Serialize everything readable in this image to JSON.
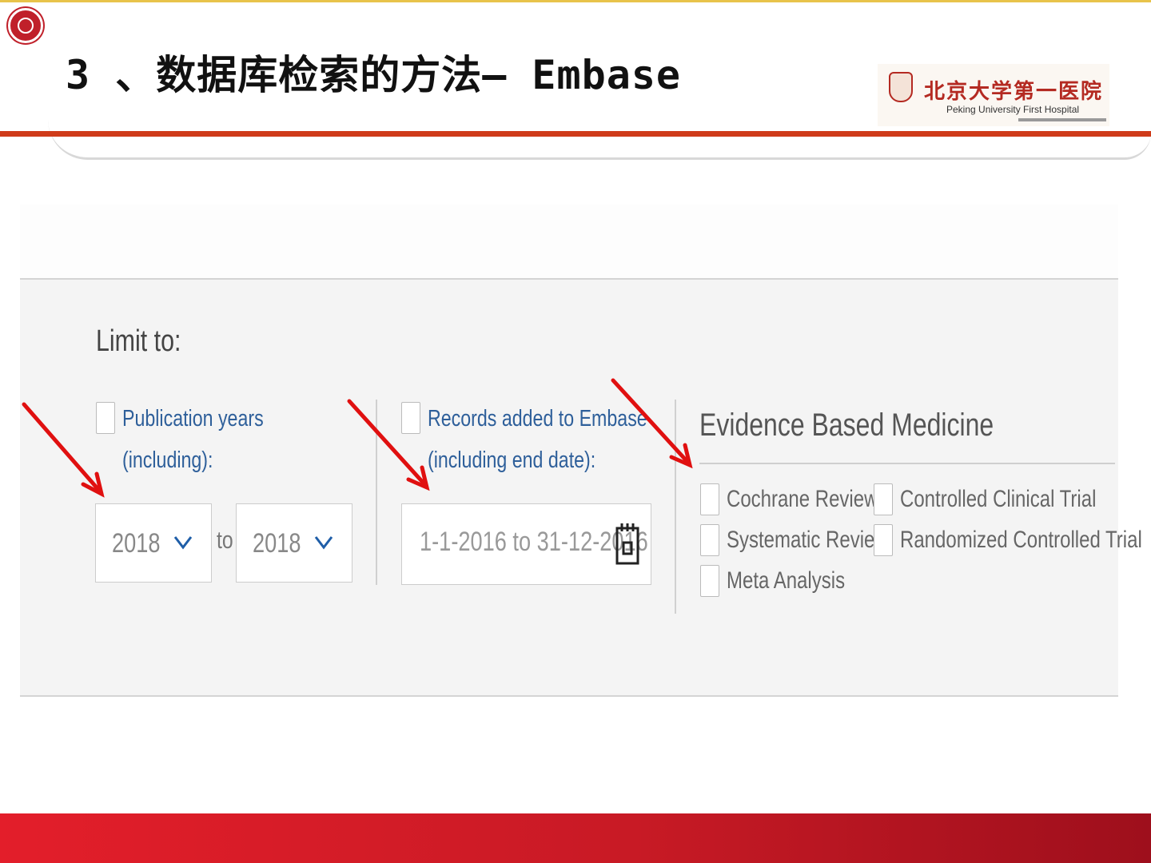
{
  "slide": {
    "title": "3 、数据库检索的方法— Embase",
    "hospital_logo": {
      "name_cn": "北京大学第一医院",
      "name_en": "Peking University First Hospital"
    }
  },
  "form": {
    "limit_label": "Limit to:",
    "publication_years": {
      "label_line1": "Publication years",
      "label_line2": "(including):",
      "from_value": "2018",
      "to_label": "to",
      "to_value": "2018",
      "checked": false
    },
    "records_added": {
      "label_line1": "Records added to Embase",
      "label_line2": "(including end date):",
      "date_range": "1-1-2016 to 31-12-2016",
      "checked": false
    },
    "evidence_based_medicine": {
      "title": "Evidence Based Medicine",
      "options": [
        {
          "label": "Cochrane Review",
          "checked": false
        },
        {
          "label": "Controlled Clinical Trial",
          "checked": false
        },
        {
          "label": "Systematic Review",
          "checked": false
        },
        {
          "label": "Randomized Controlled Trial",
          "checked": false
        },
        {
          "label": "Meta Analysis",
          "checked": false
        }
      ]
    }
  },
  "colors": {
    "header_rule": "#cf3b1a",
    "label_blue": "#2e5f9a",
    "chevron_blue": "#1f5ea8",
    "annotation_arrow": "#e01010",
    "footer_red": "#d41c27"
  },
  "icons": [
    "university-logo-icon",
    "chevron-down-icon",
    "calendar-icon",
    "annotation-arrow-icon"
  ]
}
